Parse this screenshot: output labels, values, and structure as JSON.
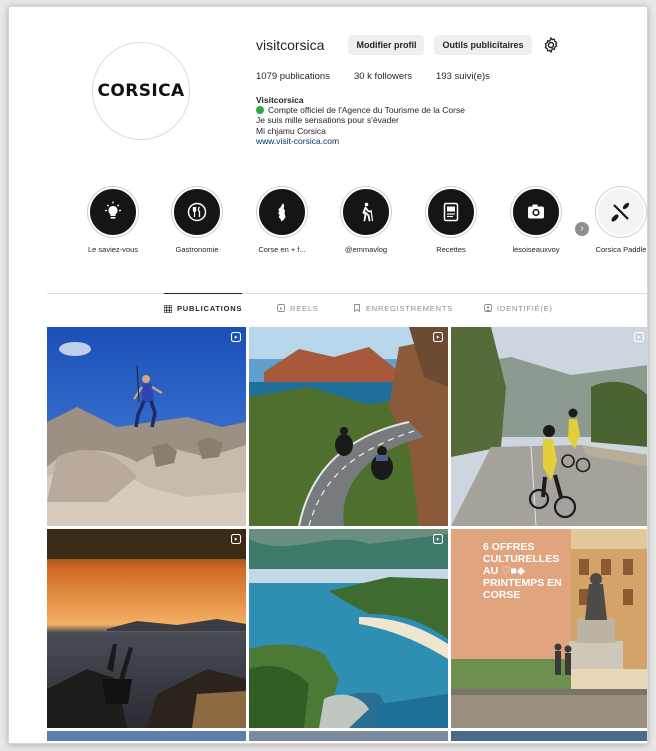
{
  "profile": {
    "username": "visitcorsica",
    "edit_button": "Modifier profil",
    "tools_button": "Outils publicitaires",
    "logo_text": "CORSICA",
    "stats": {
      "publications": "1079 publications",
      "followers": "30 k followers",
      "following": "193 suivi(e)s"
    },
    "bio": {
      "name": "Visitcorsica",
      "category": "Compte officiel de l'Agence du Tourisme de la Corse",
      "line1": "Je suis mille sensations pour s'évader",
      "line2": "Mi chjamu Corsica",
      "link": "www.visit-corsica.com"
    }
  },
  "highlights": [
    {
      "label": "Le saviez-vous",
      "icon": "lightbulb-icon"
    },
    {
      "label": "Gastronomie",
      "icon": "cutlery-icon"
    },
    {
      "label": "Corse en + f...",
      "icon": "corsica-map-icon"
    },
    {
      "label": "@emmavlog",
      "icon": "hiker-icon"
    },
    {
      "label": "Recettes",
      "icon": "recipe-book-icon"
    },
    {
      "label": "lesoiseauxvoy",
      "icon": "camera-icon"
    },
    {
      "label": "Corsica Paddle",
      "icon": "paddle-icon"
    }
  ],
  "tabs": [
    {
      "label": "PUBLICATIONS",
      "icon": "grid-icon",
      "active": true
    },
    {
      "label": "REELS",
      "icon": "reels-icon",
      "active": false
    },
    {
      "label": "ENREGISTREMENTS",
      "icon": "bookmark-icon",
      "active": false
    },
    {
      "label": "IDENTIFIÉ(E)",
      "icon": "tag-icon",
      "active": false
    }
  ],
  "posts": [
    {
      "subject": "trail runner on granite rocks",
      "reel": true
    },
    {
      "subject": "motorcycles on coastal road",
      "reel": true
    },
    {
      "subject": "cyclists on mountain road",
      "reel": true
    },
    {
      "subject": "sunset over the bay",
      "reel": true
    },
    {
      "subject": "aerial view of beach and cove",
      "reel": true
    },
    {
      "subject": "statue on town square",
      "reel": false,
      "promo_text": "6 OFFRES CULTURELLES AU ♡■◆ PRINTEMPS EN CORSE"
    }
  ],
  "colors": {
    "verified_dot": "#2ca94d",
    "link": "#00376b",
    "promo_panel": "#e0a47e"
  }
}
